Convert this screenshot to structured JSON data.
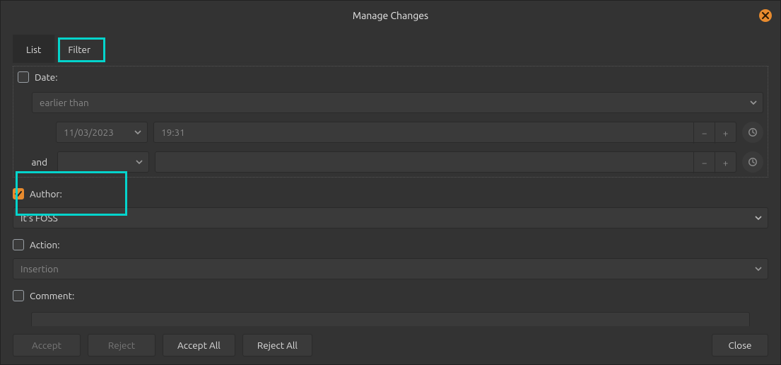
{
  "title": "Manage Changes",
  "tabs": {
    "list": "List",
    "filter": "Filter"
  },
  "date": {
    "label": "Date:",
    "condition": "earlier than",
    "date_value": "11/03/2023",
    "time_value": "19:31",
    "and_label": "and"
  },
  "author": {
    "label": "Author:",
    "value": "It's FOSS"
  },
  "action": {
    "label": "Action:",
    "value": "Insertion"
  },
  "comment": {
    "label": "Comment:"
  },
  "footer": {
    "accept": "Accept",
    "reject": "Reject",
    "accept_all": "Accept All",
    "reject_all": "Reject All",
    "close": "Close"
  }
}
